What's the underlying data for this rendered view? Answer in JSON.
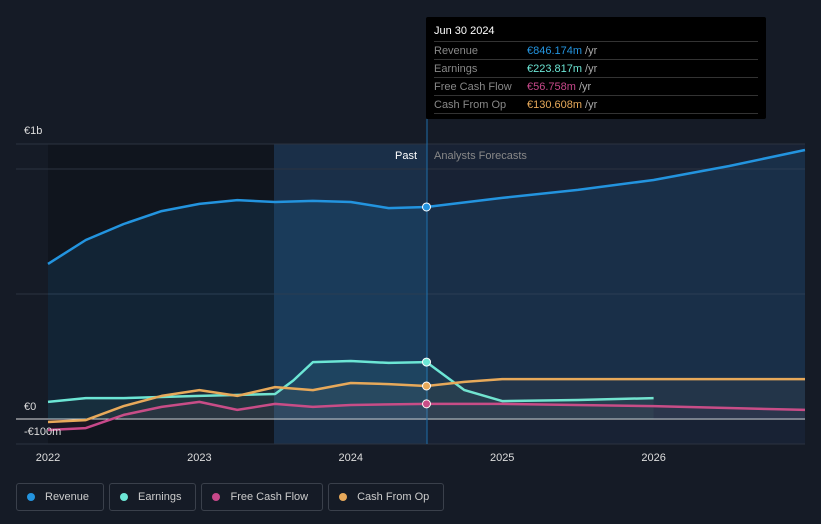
{
  "chart_data": {
    "type": "line",
    "y_unit": "€m",
    "ylim": [
      -100,
      1000
    ],
    "xlim": [
      2022,
      2027
    ],
    "y_tick_labels": [
      "€1b",
      "€0",
      "-€100m"
    ],
    "x_tick_labels": [
      "2022",
      "2023",
      "2024",
      "2025",
      "2026"
    ],
    "regions": {
      "past": "Past",
      "forecast": "Analysts Forecasts",
      "divider_x": 2024.5
    },
    "series": [
      {
        "name": "Revenue",
        "color": "#2394df",
        "x": [
          2022,
          2022.25,
          2022.5,
          2022.75,
          2023,
          2023.25,
          2023.5,
          2023.75,
          2024,
          2024.25,
          2024.5,
          2025,
          2025.5,
          2026,
          2026.5,
          2027
        ],
        "values": [
          564,
          651,
          709,
          756,
          782,
          796,
          789,
          793,
          789,
          767,
          771,
          804,
          833,
          869,
          920,
          978
        ]
      },
      {
        "name": "Earnings",
        "color": "#6ce6d5",
        "x": [
          2022,
          2022.25,
          2022.5,
          2023,
          2023.5,
          2023.62,
          2023.75,
          2024,
          2024.25,
          2024.5,
          2024.75,
          2025,
          2025.5,
          2026
        ],
        "values": [
          62,
          76,
          76,
          84,
          91,
          140,
          207,
          211,
          204,
          207,
          105,
          65,
          69,
          76
        ]
      },
      {
        "name": "Free Cash Flow",
        "color": "#c7488a",
        "x": [
          2022,
          2022.25,
          2022.5,
          2022.75,
          2023,
          2023.25,
          2023.5,
          2023.75,
          2024,
          2024.5,
          2025,
          2026,
          2027
        ],
        "values": [
          -40,
          -33,
          15,
          44,
          62,
          33,
          55,
          44,
          51,
          55,
          55,
          47,
          33
        ]
      },
      {
        "name": "Cash From Op",
        "color": "#e7a95a",
        "x": [
          2022,
          2022.25,
          2022.5,
          2022.75,
          2023,
          2023.25,
          2023.5,
          2023.75,
          2024,
          2024.25,
          2024.5,
          2024.75,
          2025,
          2026,
          2027
        ],
        "values": [
          -11,
          -4,
          47,
          84,
          105,
          84,
          116,
          105,
          131,
          127,
          120,
          135,
          145,
          145,
          145
        ]
      }
    ]
  },
  "tooltip": {
    "date": "Jun 30 2024",
    "rows": [
      {
        "label": "Revenue",
        "value": "€846.174m",
        "unit": "/yr",
        "color": "#2394df"
      },
      {
        "label": "Earnings",
        "value": "€223.817m",
        "unit": "/yr",
        "color": "#6ce6d5"
      },
      {
        "label": "Free Cash Flow",
        "value": "€56.758m",
        "unit": "/yr",
        "color": "#c7488a"
      },
      {
        "label": "Cash From Op",
        "value": "€130.608m",
        "unit": "/yr",
        "color": "#e7a95a"
      }
    ]
  }
}
